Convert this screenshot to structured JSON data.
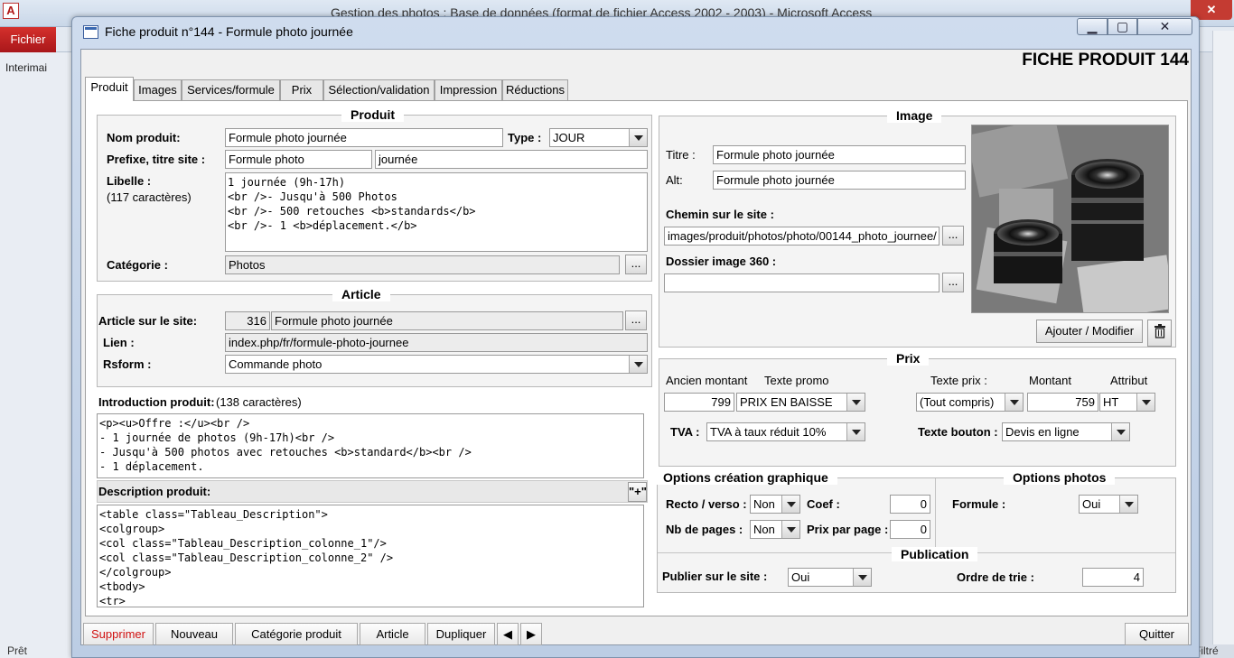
{
  "app": {
    "title": "Gestion des photos : Base de données (format de fichier Access 2002 - 2003) - Microsoft Access",
    "file_tab": "Fichier",
    "nav_item": "Interimai",
    "status_left": "Prêt",
    "status_right": "Filtré",
    "logo": "A"
  },
  "window": {
    "title": "Fiche produit n°144 - Formule photo journée",
    "header": "FICHE PRODUIT 144"
  },
  "tabs": [
    {
      "label": "Produit"
    },
    {
      "label": "Images"
    },
    {
      "label": "Services/formule"
    },
    {
      "label": "Prix"
    },
    {
      "label": "Sélection/validation"
    },
    {
      "label": "Impression"
    },
    {
      "label": "Réductions"
    }
  ],
  "produit": {
    "title": "Produit",
    "nom_label": "Nom produit:",
    "nom_value": "Formule photo journée",
    "type_label": "Type :",
    "type_value": "JOUR",
    "prefixe_label": "Prefixe, titre site :",
    "prefixe_value": "Formule photo",
    "titre_site_value": "journée",
    "libelle_label": "Libelle :",
    "libelle_count": "(117 caractères)",
    "libelle_value": "1 journée (9h-17h)\n<br />- Jusqu'à 500 Photos\n<br />- 500 retouches <b>standards</b>\n<br />- 1 <b>déplacement.</b>",
    "categorie_label": "Catégorie :",
    "categorie_value": "Photos",
    "ellipsis": "..."
  },
  "article": {
    "title": "Article",
    "article_label": "Article sur le site:",
    "article_id": "316",
    "article_value": "Formule photo journée",
    "lien_label": "Lien :",
    "lien_value": "index.php/fr/formule-photo-journee",
    "rsform_label": "Rsform :",
    "rsform_value": "Commande photo"
  },
  "introduction": {
    "label": "Introduction produit:",
    "count": "(138 caractères)",
    "value": "<p><u>Offre :</u><br />\n- 1 journée de photos (9h-17h)<br />\n- Jusqu'à 500 photos avec retouches <b>standard</b><br />\n- 1 déplacement."
  },
  "description": {
    "label": "Description produit:",
    "expand": "\"+\"",
    "value": "<table class=\"Tableau_Description\">\n<colgroup>\n<col class=\"Tableau_Description_colonne_1\"/>\n<col class=\"Tableau_Description_colonne_2\" />\n</colgroup>\n<tbody>\n<tr>"
  },
  "image": {
    "title": "Image",
    "titre_label": "Titre :",
    "titre_value": "Formule photo journée",
    "alt_label": "Alt:",
    "alt_value": "Formule photo journée",
    "chemin_label": "Chemin sur le site :",
    "chemin_value": "images/produit/photos/photo/00144_photo_journee/",
    "dossier_label": "Dossier image 360 :",
    "dossier_value": "",
    "ajouter_label": "Ajouter / Modifier",
    "trash_icon": "trash-icon"
  },
  "prix": {
    "title": "Prix",
    "ancien_label": "Ancien montant",
    "ancien_value": "799",
    "promo_label": "Texte promo",
    "promo_value": "PRIX EN BAISSE",
    "texte_prix_label": "Texte prix :",
    "texte_prix_value": "(Tout compris)",
    "montant_label": "Montant",
    "montant_value": "759",
    "attribut_label": "Attribut",
    "attribut_value": "HT",
    "tva_label": "TVA :",
    "tva_value": "TVA à taux réduit 10%",
    "bouton_label": "Texte bouton :",
    "bouton_value": "Devis en ligne"
  },
  "options_graphique": {
    "title": "Options création graphique",
    "recto_label": "Recto / verso :",
    "recto_value": "Non",
    "coef_label": "Coef :",
    "coef_value": "0",
    "pages_label": "Nb de pages :",
    "pages_value": "Non",
    "prix_page_label": "Prix par page :",
    "prix_page_value": "0"
  },
  "options_photos": {
    "title": "Options photos",
    "formule_label": "Formule :",
    "formule_value": "Oui"
  },
  "publication": {
    "title": "Publication",
    "publier_label": "Publier sur le site :",
    "publier_value": "Oui",
    "ordre_label": "Ordre de trie :",
    "ordre_value": "4"
  },
  "footer": {
    "supprimer": "Supprimer",
    "nouveau": "Nouveau",
    "categorie": "Catégorie produit",
    "article": "Article",
    "dupliquer": "Dupliquer",
    "quitter": "Quitter",
    "danger_color": "#d01010"
  }
}
